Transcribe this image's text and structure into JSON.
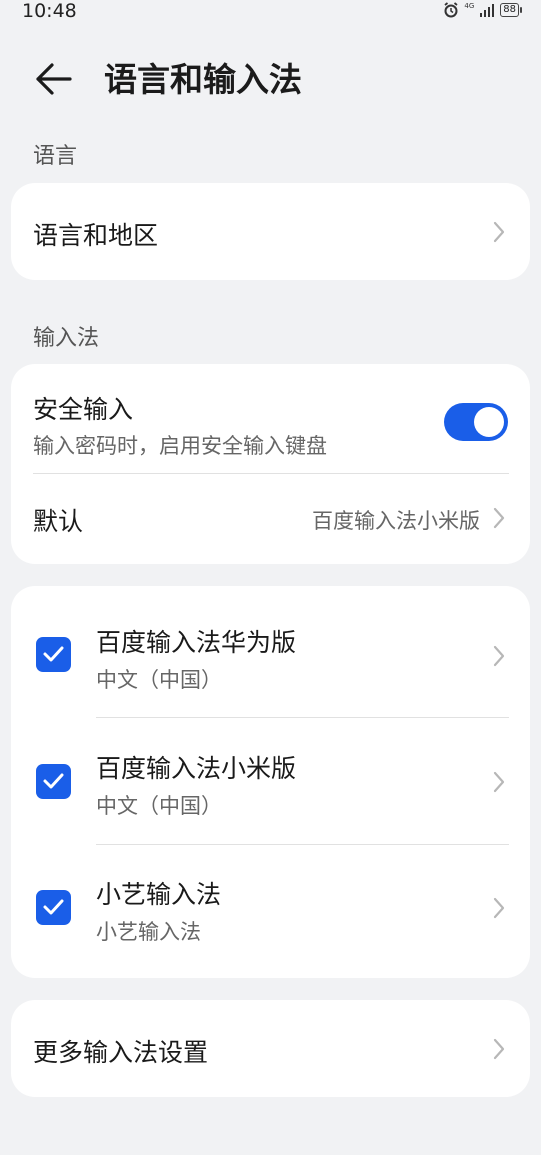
{
  "status_bar": {
    "time": "10:48",
    "network": "4G",
    "battery": "88",
    "icons": [
      "alarm-icon",
      "signal-icon",
      "battery-icon"
    ]
  },
  "header": {
    "title": "语言和输入法",
    "back_icon": "arrow-left-icon"
  },
  "sections": {
    "language": {
      "label": "语言",
      "rows": [
        {
          "title": "语言和地区"
        }
      ]
    },
    "input_method": {
      "label": "输入法",
      "secure_input": {
        "title": "安全输入",
        "subtitle": "输入密码时，启用安全输入键盘",
        "enabled": true
      },
      "default": {
        "title": "默认",
        "value": "百度输入法小米版"
      }
    }
  },
  "input_methods": [
    {
      "name": "百度输入法华为版",
      "language": "中文（中国）",
      "checked": true
    },
    {
      "name": "百度输入法小米版",
      "language": "中文（中国）",
      "checked": true
    },
    {
      "name": "小艺输入法",
      "language": "小艺输入法",
      "checked": true
    }
  ],
  "more_settings": {
    "title": "更多输入法设置"
  },
  "colors": {
    "accent": "#1a5ee8",
    "background": "#f1f2f4",
    "card": "#ffffff"
  }
}
